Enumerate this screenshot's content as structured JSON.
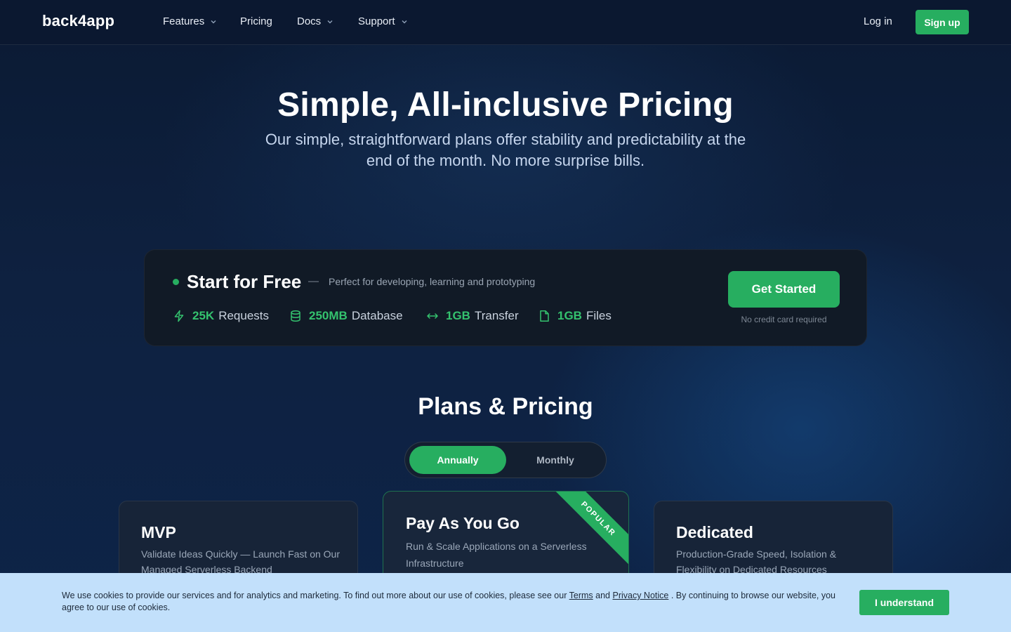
{
  "nav": {
    "logo": "back4app",
    "items": [
      {
        "label": "Features",
        "has_dropdown": true
      },
      {
        "label": "Pricing",
        "has_dropdown": false
      },
      {
        "label": "Docs",
        "has_dropdown": true
      },
      {
        "label": "Support",
        "has_dropdown": true
      }
    ],
    "login": "Log in",
    "signup": "Sign up"
  },
  "hero": {
    "title": "Simple, All-inclusive Pricing",
    "subtitle": "Our simple, straightforward plans offer stability and predictability at the end of the month. No more surprise bills."
  },
  "free": {
    "title": "Start for Free",
    "dash": "—",
    "description": "Perfect for developing, learning and prototyping",
    "features": [
      {
        "icon": "bolt-icon",
        "value": "25K",
        "label": "Requests"
      },
      {
        "icon": "database-icon",
        "value": "250MB",
        "label": "Database"
      },
      {
        "icon": "arrows-horizontal-icon",
        "value": "1GB",
        "label": "Transfer"
      },
      {
        "icon": "file-icon",
        "value": "1GB",
        "label": "Files"
      }
    ],
    "cta": "Get Started",
    "note": "No credit card required"
  },
  "plans": {
    "title": "Plans & Pricing",
    "toggle": {
      "annual": "Annually",
      "monthly": "Monthly",
      "selected": "Annually"
    },
    "cards": [
      {
        "name": "MVP",
        "description": "Validate Ideas Quickly — Launch Fast on Our Managed Serverless Backend"
      },
      {
        "name": "Pay As You Go",
        "description": "Run & Scale Applications on a Serverless Infrastructure",
        "badge": "POPULAR"
      },
      {
        "name": "Dedicated",
        "description": "Production-Grade Speed, Isolation & Flexibility on Dedicated Resources"
      }
    ]
  },
  "cookie": {
    "text_before": "We use cookies to provide our services and for analytics and marketing. To find out more about our use of cookies, please see our ",
    "terms": "Terms",
    "and": " and ",
    "privacy": "Privacy Notice",
    "text_after": " . By continuing to browse our website, you agree to our use of cookies.",
    "button": "I understand"
  },
  "colors": {
    "accent": "#27ae60",
    "background": "#0d1b33",
    "cookie_bar": "#c2e0fb"
  }
}
